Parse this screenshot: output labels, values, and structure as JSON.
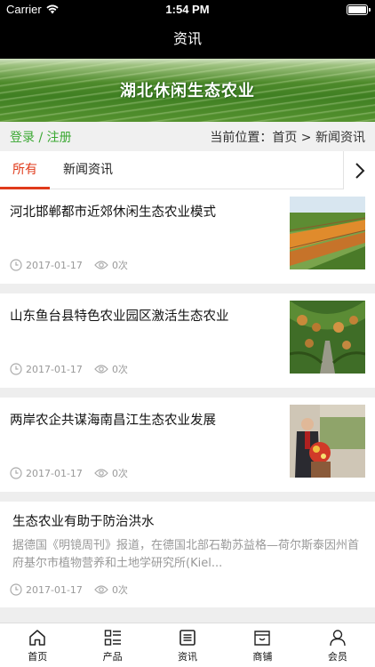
{
  "status_bar": {
    "carrier": "Carrier",
    "time": "1:54 PM"
  },
  "nav": {
    "title": "资讯"
  },
  "banner": {
    "text": "湖北休闲生态农业"
  },
  "crumbs": {
    "login": "登录",
    "separator": " / ",
    "register": "注册",
    "location_label": "当前位置：首页 > 新闻资讯"
  },
  "tabs": [
    {
      "label": "所有",
      "active": true
    },
    {
      "label": "新闻资讯",
      "active": false
    }
  ],
  "articles": [
    {
      "title": "河北邯郸都市近郊休闲生态农业模式",
      "date": "2017-01-17",
      "views": "0次"
    },
    {
      "title": "山东鱼台县特色农业园区激活生态农业",
      "date": "2017-01-17",
      "views": "0次"
    },
    {
      "title": "两岸农企共谋海南昌江生态农业发展",
      "date": "2017-01-17",
      "views": "0次"
    },
    {
      "title": "生态农业有助于防治洪水",
      "excerpt": "据德国《明镜周刊》报道，在德国北部石勒苏益格—荷尔斯泰因州首府基尔市植物营养和土地学研究所(Kiel...",
      "date": "2017-01-17",
      "views": "0次"
    }
  ],
  "tabbar": [
    {
      "label": "首页",
      "icon": "home-icon"
    },
    {
      "label": "产品",
      "icon": "grid-list-icon"
    },
    {
      "label": "资讯",
      "icon": "news-icon"
    },
    {
      "label": "商铺",
      "icon": "shop-icon"
    },
    {
      "label": "会员",
      "icon": "user-icon"
    }
  ]
}
